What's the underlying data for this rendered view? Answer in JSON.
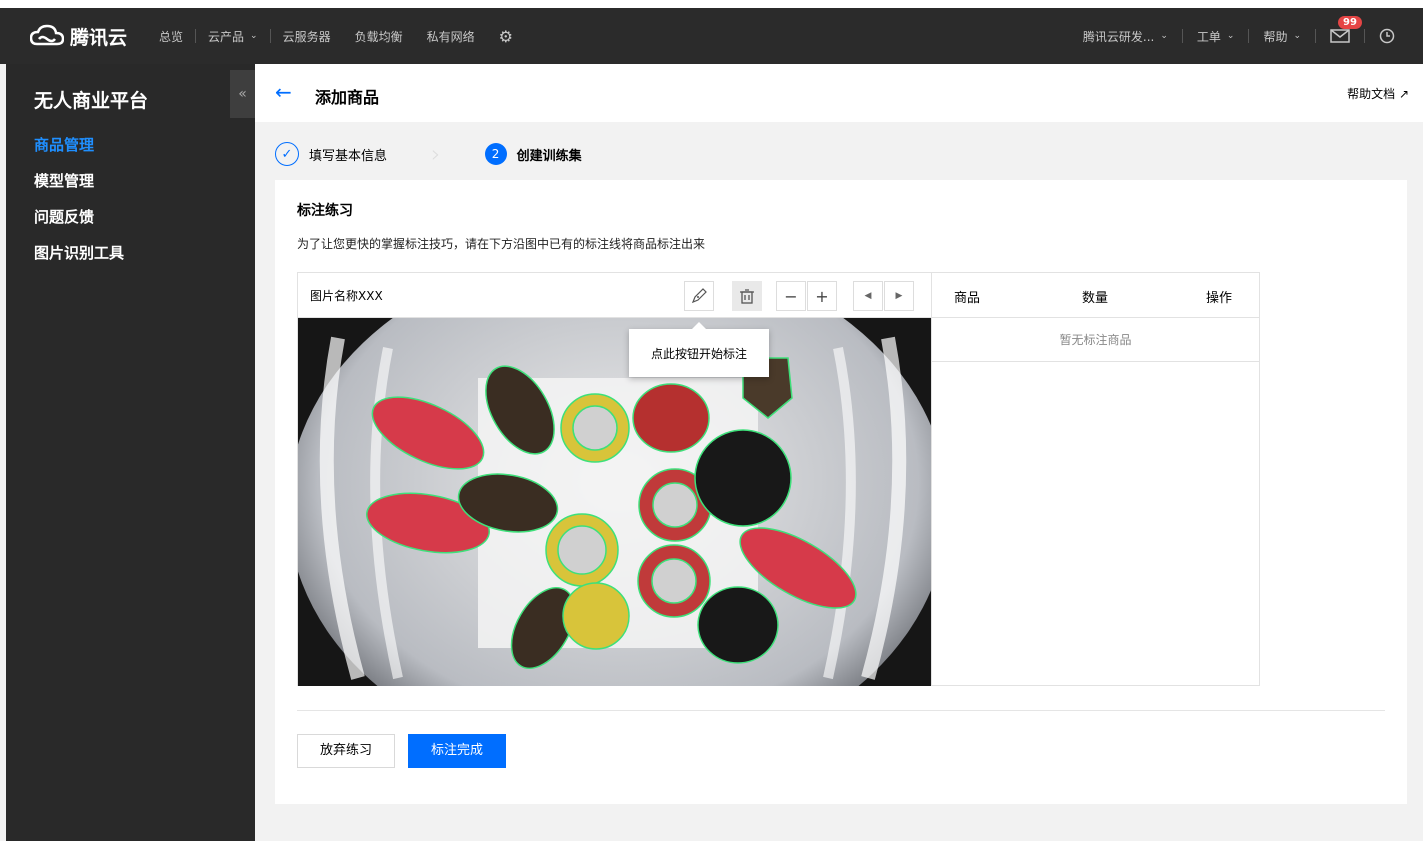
{
  "topbar": {
    "brand": "腾讯云",
    "nav": [
      "总览",
      "云产品",
      "云服务器",
      "负载均衡",
      "私有网络"
    ],
    "account": "腾讯云研发...",
    "ticket": "工单",
    "help": "帮助",
    "mail_count": "99"
  },
  "sidebar": {
    "title": "无人商业平台",
    "collapse_glyph": "«",
    "items": [
      {
        "label": "商品管理",
        "active": true
      },
      {
        "label": "模型管理",
        "active": false
      },
      {
        "label": "问题反馈",
        "active": false
      },
      {
        "label": "图片识别工具",
        "active": false
      }
    ]
  },
  "header": {
    "back_glyph": "←",
    "title": "添加商品",
    "help_doc": "帮助文档"
  },
  "steps": [
    {
      "index": "1",
      "label": "填写基本信息",
      "done": true
    },
    {
      "index": "2",
      "label": "创建训练集",
      "done": false
    }
  ],
  "card": {
    "title": "标注练习",
    "description": "为了让您更快的掌握标注技巧，请在下方沿图中已有的标注线将商品标注出来",
    "image_name": "图片名称XXX",
    "tooltip": "点此按钮开始标注",
    "table_headers": [
      "商品",
      "数量",
      "操作"
    ],
    "empty_text": "暂无标注商品",
    "abandon_button": "放弃练习",
    "done_button": "标注完成"
  },
  "colors": {
    "accent": "#006eff",
    "topbar_bg": "#2b2b2b",
    "sidebar_bg": "#292929",
    "annotation_outline": "#3ee07a"
  }
}
